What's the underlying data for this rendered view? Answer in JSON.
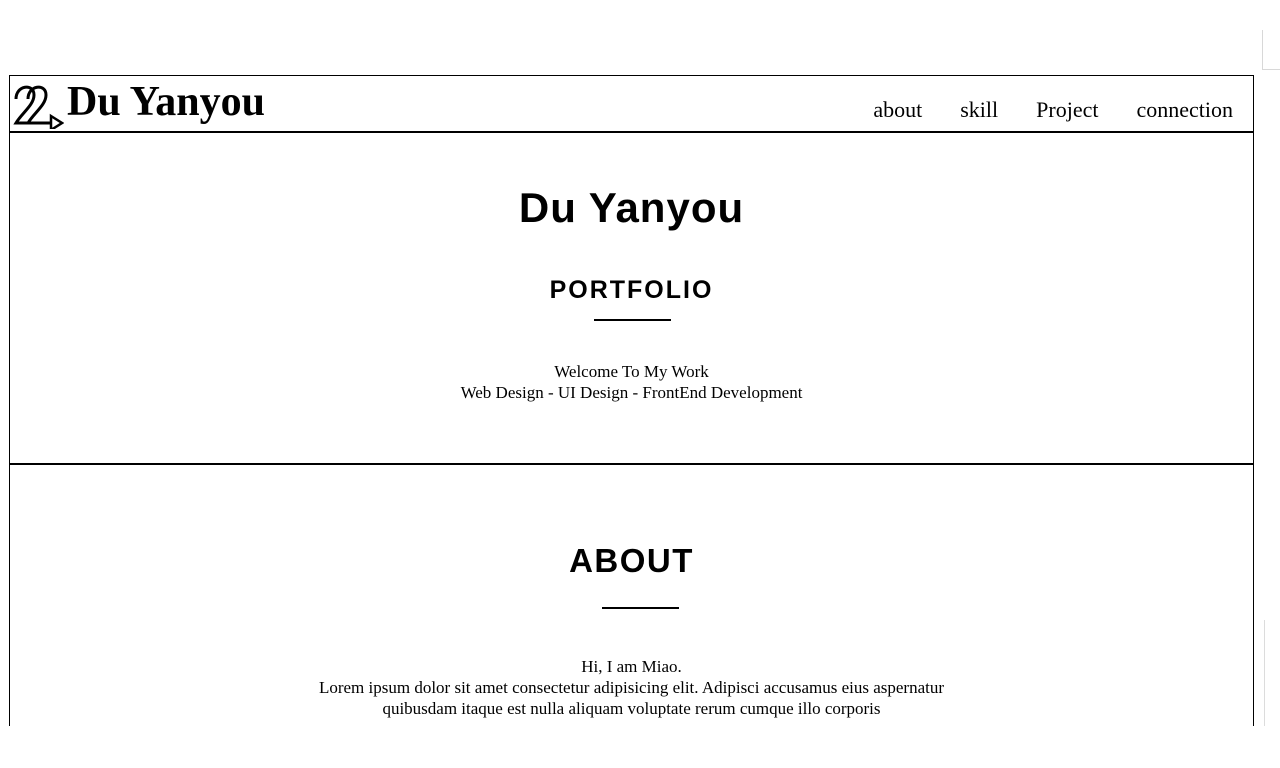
{
  "header": {
    "brand": "Du Yanyou",
    "logo_icon": "du-monogram-logo",
    "nav": [
      {
        "label": "about"
      },
      {
        "label": "skill"
      },
      {
        "label": "Project"
      },
      {
        "label": "connection"
      }
    ]
  },
  "hero": {
    "title": "Du Yanyou",
    "subtitle": "PORTFOLIO",
    "line1": "Welcome To My Work",
    "line2": "Web Design - UI Design - FrontEnd Development"
  },
  "about": {
    "title": "ABOUT",
    "greeting": "Hi, I am Miao.",
    "body": "Lorem ipsum dolor sit amet consectetur adipisicing elit. Adipisci accusamus eius aspernatur quibusdam itaque est nulla aliquam voluptate rerum cumque illo corporis"
  }
}
